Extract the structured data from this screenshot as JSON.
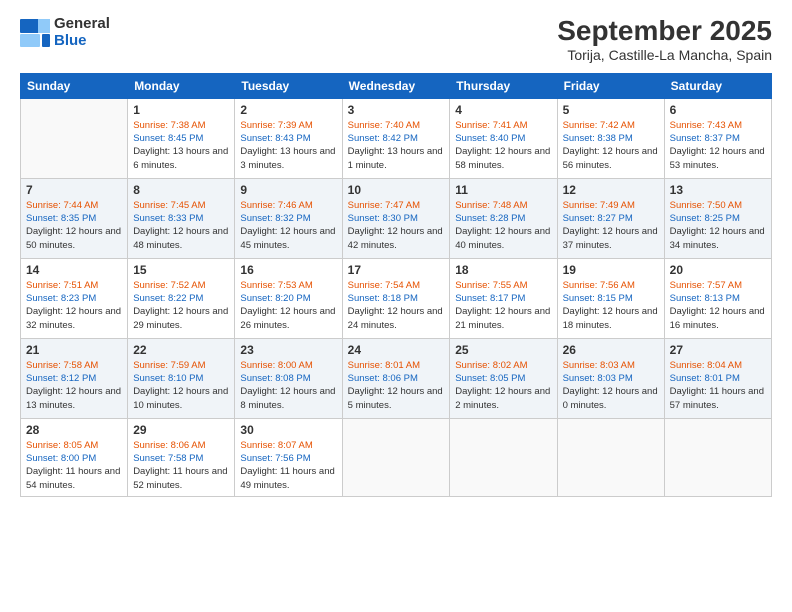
{
  "logo": {
    "line1": "General",
    "line2": "Blue"
  },
  "title": "September 2025",
  "subtitle": "Torija, Castille-La Mancha, Spain",
  "weekdays": [
    "Sunday",
    "Monday",
    "Tuesday",
    "Wednesday",
    "Thursday",
    "Friday",
    "Saturday"
  ],
  "weeks": [
    [
      {
        "num": "",
        "sunrise": "",
        "sunset": "",
        "daylight": ""
      },
      {
        "num": "1",
        "sunrise": "7:38 AM",
        "sunset": "8:45 PM",
        "daylight": "13 hours and 6 minutes."
      },
      {
        "num": "2",
        "sunrise": "7:39 AM",
        "sunset": "8:43 PM",
        "daylight": "13 hours and 3 minutes."
      },
      {
        "num": "3",
        "sunrise": "7:40 AM",
        "sunset": "8:42 PM",
        "daylight": "13 hours and 1 minute."
      },
      {
        "num": "4",
        "sunrise": "7:41 AM",
        "sunset": "8:40 PM",
        "daylight": "12 hours and 58 minutes."
      },
      {
        "num": "5",
        "sunrise": "7:42 AM",
        "sunset": "8:38 PM",
        "daylight": "12 hours and 56 minutes."
      },
      {
        "num": "6",
        "sunrise": "7:43 AM",
        "sunset": "8:37 PM",
        "daylight": "12 hours and 53 minutes."
      }
    ],
    [
      {
        "num": "7",
        "sunrise": "7:44 AM",
        "sunset": "8:35 PM",
        "daylight": "12 hours and 50 minutes."
      },
      {
        "num": "8",
        "sunrise": "7:45 AM",
        "sunset": "8:33 PM",
        "daylight": "12 hours and 48 minutes."
      },
      {
        "num": "9",
        "sunrise": "7:46 AM",
        "sunset": "8:32 PM",
        "daylight": "12 hours and 45 minutes."
      },
      {
        "num": "10",
        "sunrise": "7:47 AM",
        "sunset": "8:30 PM",
        "daylight": "12 hours and 42 minutes."
      },
      {
        "num": "11",
        "sunrise": "7:48 AM",
        "sunset": "8:28 PM",
        "daylight": "12 hours and 40 minutes."
      },
      {
        "num": "12",
        "sunrise": "7:49 AM",
        "sunset": "8:27 PM",
        "daylight": "12 hours and 37 minutes."
      },
      {
        "num": "13",
        "sunrise": "7:50 AM",
        "sunset": "8:25 PM",
        "daylight": "12 hours and 34 minutes."
      }
    ],
    [
      {
        "num": "14",
        "sunrise": "7:51 AM",
        "sunset": "8:23 PM",
        "daylight": "12 hours and 32 minutes."
      },
      {
        "num": "15",
        "sunrise": "7:52 AM",
        "sunset": "8:22 PM",
        "daylight": "12 hours and 29 minutes."
      },
      {
        "num": "16",
        "sunrise": "7:53 AM",
        "sunset": "8:20 PM",
        "daylight": "12 hours and 26 minutes."
      },
      {
        "num": "17",
        "sunrise": "7:54 AM",
        "sunset": "8:18 PM",
        "daylight": "12 hours and 24 minutes."
      },
      {
        "num": "18",
        "sunrise": "7:55 AM",
        "sunset": "8:17 PM",
        "daylight": "12 hours and 21 minutes."
      },
      {
        "num": "19",
        "sunrise": "7:56 AM",
        "sunset": "8:15 PM",
        "daylight": "12 hours and 18 minutes."
      },
      {
        "num": "20",
        "sunrise": "7:57 AM",
        "sunset": "8:13 PM",
        "daylight": "12 hours and 16 minutes."
      }
    ],
    [
      {
        "num": "21",
        "sunrise": "7:58 AM",
        "sunset": "8:12 PM",
        "daylight": "12 hours and 13 minutes."
      },
      {
        "num": "22",
        "sunrise": "7:59 AM",
        "sunset": "8:10 PM",
        "daylight": "12 hours and 10 minutes."
      },
      {
        "num": "23",
        "sunrise": "8:00 AM",
        "sunset": "8:08 PM",
        "daylight": "12 hours and 8 minutes."
      },
      {
        "num": "24",
        "sunrise": "8:01 AM",
        "sunset": "8:06 PM",
        "daylight": "12 hours and 5 minutes."
      },
      {
        "num": "25",
        "sunrise": "8:02 AM",
        "sunset": "8:05 PM",
        "daylight": "12 hours and 2 minutes."
      },
      {
        "num": "26",
        "sunrise": "8:03 AM",
        "sunset": "8:03 PM",
        "daylight": "12 hours and 0 minutes."
      },
      {
        "num": "27",
        "sunrise": "8:04 AM",
        "sunset": "8:01 PM",
        "daylight": "11 hours and 57 minutes."
      }
    ],
    [
      {
        "num": "28",
        "sunrise": "8:05 AM",
        "sunset": "8:00 PM",
        "daylight": "11 hours and 54 minutes."
      },
      {
        "num": "29",
        "sunrise": "8:06 AM",
        "sunset": "7:58 PM",
        "daylight": "11 hours and 52 minutes."
      },
      {
        "num": "30",
        "sunrise": "8:07 AM",
        "sunset": "7:56 PM",
        "daylight": "11 hours and 49 minutes."
      },
      {
        "num": "",
        "sunrise": "",
        "sunset": "",
        "daylight": ""
      },
      {
        "num": "",
        "sunrise": "",
        "sunset": "",
        "daylight": ""
      },
      {
        "num": "",
        "sunrise": "",
        "sunset": "",
        "daylight": ""
      },
      {
        "num": "",
        "sunrise": "",
        "sunset": "",
        "daylight": ""
      }
    ]
  ]
}
